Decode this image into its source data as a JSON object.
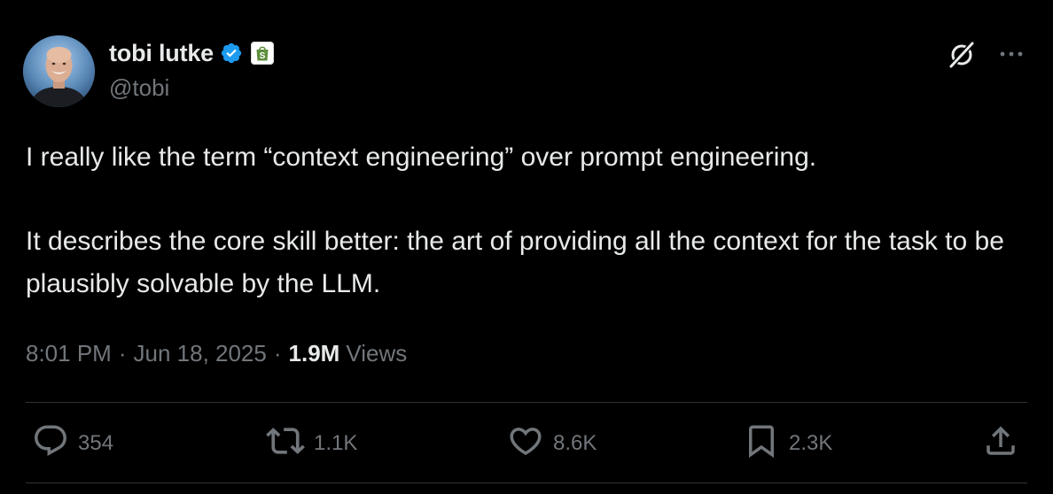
{
  "author": {
    "display_name": "tobi lutke",
    "handle": "@tobi",
    "verified": true,
    "affiliate_badge": "shopify-bag-icon"
  },
  "tweet": {
    "paragraphs": [
      "I really like the term “context engineering” over prompt engineering.",
      "It describes the core skill better: the art of providing all the context for the task to be plausibly solvable by the LLM."
    ],
    "time": "8:01 PM",
    "separator": "·",
    "date": "Jun 18, 2025",
    "views_count": "1.9M",
    "views_label": "Views"
  },
  "actions": {
    "replies": "354",
    "reposts": "1.1K",
    "likes": "8.6K",
    "bookmarks": "2.3K"
  },
  "icons": {
    "verified": "verified-badge-icon",
    "grok": "grok-icon",
    "more": "more-icon",
    "reply": "reply-icon",
    "repost": "repost-icon",
    "like": "heart-icon",
    "bookmark": "bookmark-icon",
    "share": "share-icon"
  },
  "colors": {
    "background": "#000000",
    "text_primary": "#e7e9ea",
    "text_secondary": "#71767b",
    "verified_blue": "#1d9bf0",
    "shopify_green": "#5e8e3e",
    "divider": "#2f3336"
  }
}
